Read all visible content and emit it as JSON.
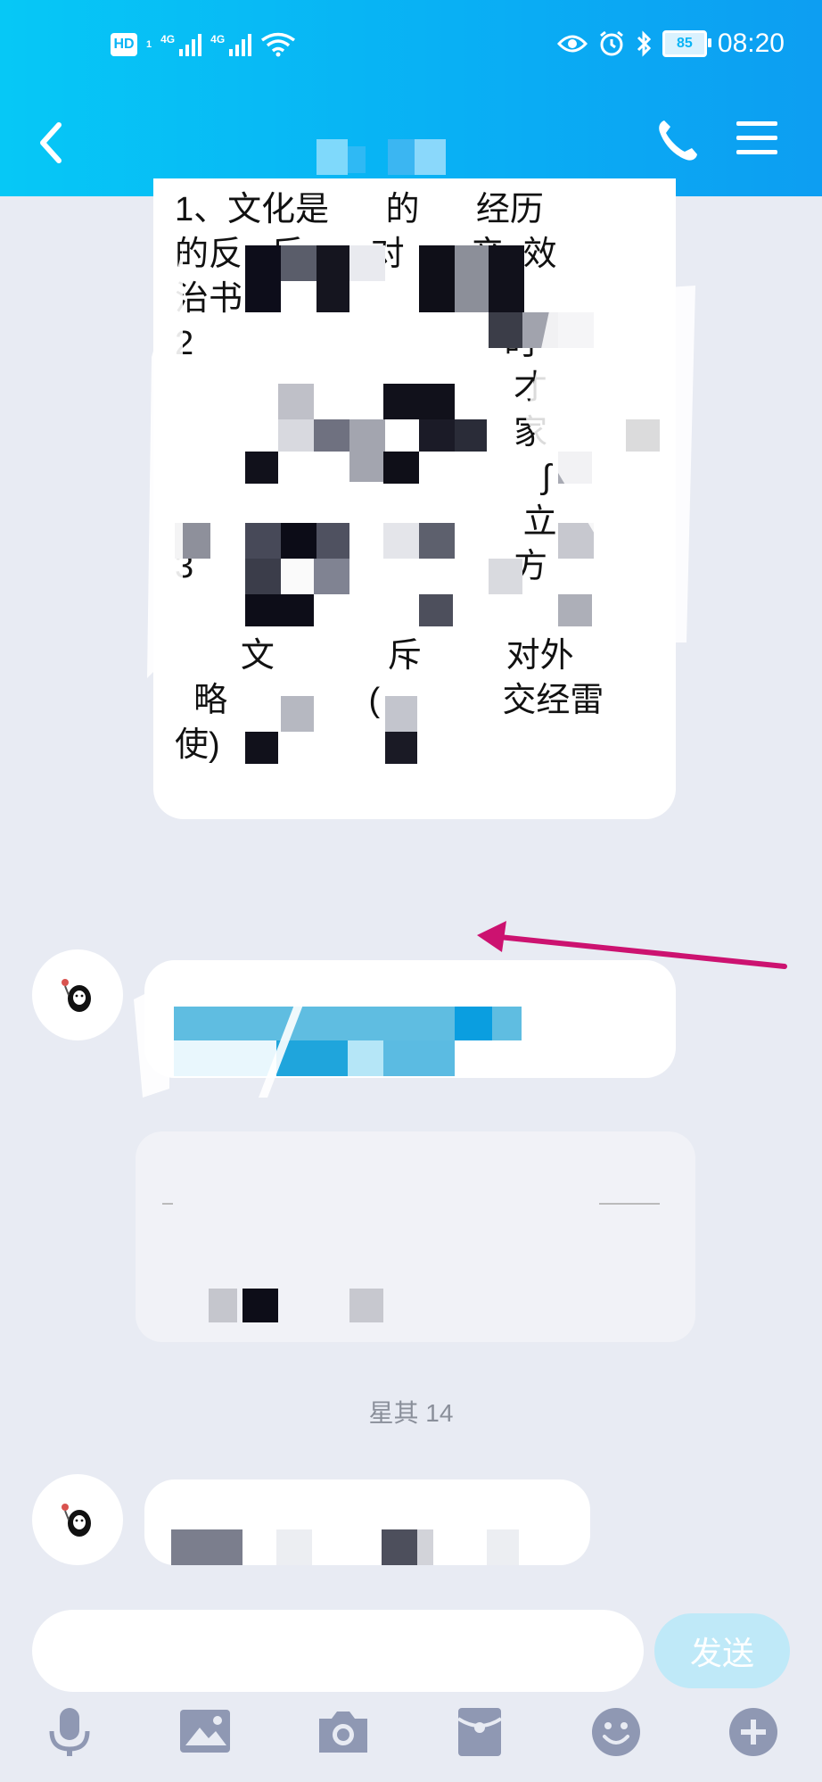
{
  "status_bar": {
    "hd": "HD",
    "sim1": "1",
    "net1": "4G",
    "net2": "4G",
    "battery": "85",
    "time": "08:20"
  },
  "messages": [
    {
      "text": "1、文化是      的      经历\n的反   反       对       产  效\n治书\n2                                 时\n                                    才\n                                    家\n                                       ∫\n                                     立\n3                                  方\n\n       文            斥         对外\n  略               (             交经雷\n使)"
    }
  ],
  "date_stamp": "星其  14",
  "input": {
    "placeholder": "",
    "send_label": "发送"
  },
  "toolbar": {
    "icons": [
      "mic-icon",
      "image-icon",
      "camera-icon",
      "red-packet-icon",
      "emoji-icon",
      "plus-icon"
    ]
  },
  "colors": {
    "header_start": "#06c8f6",
    "header_end": "#0d9ef2",
    "background": "#e8ebf3",
    "arrow": "#cc1270",
    "send_disabled": "#bfe9f8",
    "toolbar_icon": "#8f98b3"
  }
}
